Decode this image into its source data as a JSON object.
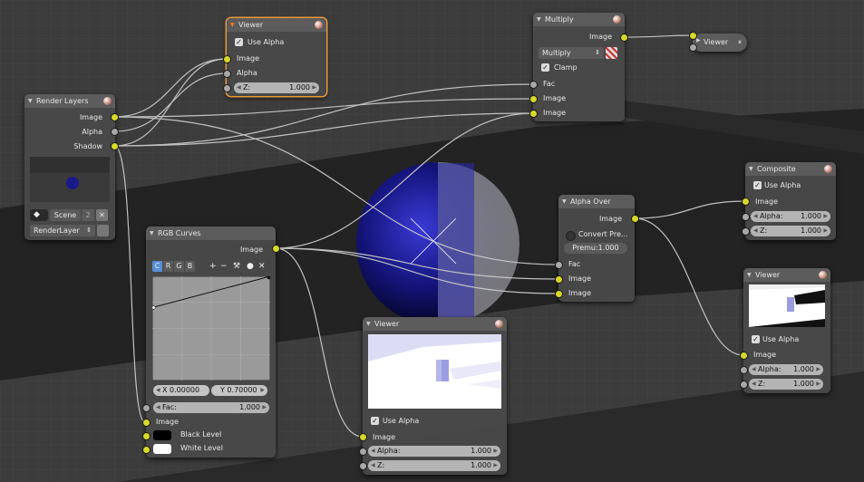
{
  "nodes": {
    "render_layers": {
      "title": "Render Layers",
      "outputs": [
        "Image",
        "Alpha",
        "Shadow"
      ],
      "scene_label": "Scene",
      "scene_users": "2",
      "layer_label": "RenderLayer"
    },
    "viewer_top": {
      "title": "Viewer",
      "use_alpha": "Use Alpha",
      "inputs": [
        "Image",
        "Alpha"
      ],
      "z_label": "Z:",
      "z_value": "1.000"
    },
    "multiply": {
      "title": "Multiply",
      "output": "Image",
      "blend_mode": "Multiply",
      "clamp": "Clamp",
      "inputs": [
        "Fac",
        "Image",
        "Image"
      ]
    },
    "viewer_collapsed": {
      "title": "Viewer"
    },
    "composite": {
      "title": "Composite",
      "use_alpha": "Use Alpha",
      "input": "Image",
      "alpha_label": "Alpha:",
      "alpha_value": "1.000",
      "z_label": "Z:",
      "z_value": "1.000"
    },
    "alpha_over": {
      "title": "Alpha Over",
      "output": "Image",
      "convert": "Convert Pre...",
      "premul": "Premu:1.000",
      "inputs": [
        "Fac",
        "Image",
        "Image"
      ]
    },
    "rgb_curves": {
      "title": "RGB Curves",
      "output": "Image",
      "channels": [
        "C",
        "R",
        "G",
        "B"
      ],
      "x_label": "X 0.00000",
      "y_label": "Y 0.70000",
      "fac_label": "Fac:",
      "fac_value": "1.000",
      "inputs": [
        "Image",
        "Black Level",
        "White Level"
      ]
    },
    "viewer_bottom": {
      "title": "Viewer",
      "use_alpha": "Use Alpha",
      "input": "Image",
      "alpha_label": "Alpha:",
      "alpha_value": "1.000",
      "z_label": "Z:",
      "z_value": "1.000"
    },
    "viewer_right": {
      "title": "Viewer",
      "use_alpha": "Use Alpha",
      "input": "Image",
      "alpha_label": "Alpha:",
      "alpha_value": "1.000",
      "z_label": "Z:",
      "z_value": "1.000"
    }
  },
  "colors": {
    "socket_color": "#d8d82a",
    "socket_grey": "#a8a8a8",
    "active_outline": "#e89a3a",
    "channel_active": "#5a8fd8",
    "sphere_blue": "#1a1a8a"
  },
  "icons": [
    "triangle-icon",
    "sphere-preview-icon",
    "check-icon",
    "plus-icon",
    "minus-icon",
    "wrench-icon",
    "dot-icon",
    "close-icon",
    "pause-icon"
  ]
}
